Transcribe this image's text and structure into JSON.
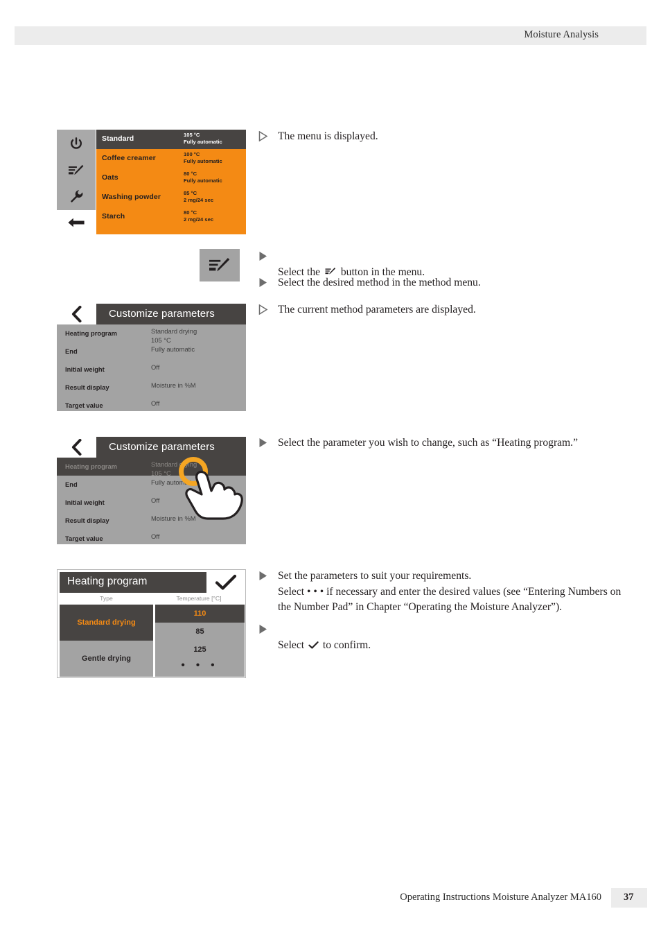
{
  "header": {
    "title": "Moisture Analysis"
  },
  "footer": {
    "text": "Operating Instructions Moisture Analyzer MA160",
    "page": "37"
  },
  "colors": {
    "orange": "#F48A14",
    "dark_gray": "#474442",
    "mid_gray": "#A3A3A3",
    "touch_ring": "#F5A623"
  },
  "screens": {
    "method_menu": {
      "sidebar": [
        {
          "icon": "power-icon"
        },
        {
          "icon": "method-edit-icon"
        },
        {
          "icon": "wrench-icon"
        },
        {
          "icon": "back-arrow-icon"
        }
      ],
      "rows": [
        {
          "name": "Standard",
          "temp": "105 °C",
          "mode": "Fully automatic",
          "selected": true
        },
        {
          "name": "Coffee creamer",
          "temp": "100 °C",
          "mode": "Fully automatic",
          "selected": false
        },
        {
          "name": "Oats",
          "temp": "80 °C",
          "mode": "Fully automatic",
          "selected": false
        },
        {
          "name": "Washing powder",
          "temp": "85 °C",
          "mode": "2 mg/24 sec",
          "selected": false
        },
        {
          "name": "Starch",
          "temp": "80 °C",
          "mode": "2 mg/24 sec",
          "selected": false
        }
      ]
    },
    "edit_button": {
      "icon": "method-edit-icon"
    },
    "customize_parameters": {
      "title": "Customize parameters",
      "back_icon": "chevron-left-icon",
      "rows": [
        {
          "label": "Heating program",
          "value": "Standard drying\n105 °C"
        },
        {
          "label": "End",
          "value": "Fully automatic"
        },
        {
          "label": "Initial weight",
          "value": "Off"
        },
        {
          "label": "Result display",
          "value": "Moisture in %M"
        },
        {
          "label": "Target value",
          "value": "Off"
        }
      ]
    },
    "customize_parameters_touch": {
      "title": "Customize parameters",
      "back_icon": "chevron-left-icon",
      "rows": [
        {
          "label": "Heating program",
          "value": "Standard drying\n105 °C",
          "highlight": true
        },
        {
          "label": "End",
          "value": "Fully automatic"
        },
        {
          "label": "Initial weight",
          "value": "Off"
        },
        {
          "label": "Result display",
          "value": "Moisture in %M"
        },
        {
          "label": "Target value",
          "value": "Off"
        }
      ],
      "touch_indicator": "hand-tap-cursor"
    },
    "heating_program": {
      "title": "Heating program",
      "confirm_icon": "checkmark-icon",
      "columns": [
        "Type",
        "Temperature [°C]"
      ],
      "types": [
        {
          "label": "Standard drying",
          "selected": true
        },
        {
          "label": "Gentle drying",
          "selected": false
        }
      ],
      "temperatures": [
        {
          "label": "110",
          "selected": true
        },
        {
          "label": "85",
          "selected": false
        },
        {
          "label": "125",
          "selected": false
        },
        {
          "label": "• • •",
          "selected": false,
          "is_dots": true
        }
      ]
    }
  },
  "instructions": [
    {
      "marker": "result",
      "text": "The menu is displayed."
    },
    {
      "marker": "action",
      "text": "Select the ❚ button in the menu.",
      "has_icon": true,
      "pre": "Select the ",
      "post": " button in the menu."
    },
    {
      "marker": "action",
      "text": "Select the desired method in the method menu."
    },
    {
      "marker": "result",
      "text": "The current method parameters are displayed."
    },
    {
      "marker": "action",
      "text": "Select the parameter you wish to change, such as “Heating program.”"
    },
    {
      "marker": "action",
      "text": "Set the parameters to suit your requirements.\nSelect • • • if necessary and enter the desired values (see “Entering Numbers on\nthe Number Pad” in Chapter “Operating the Moisture Analyzer”)."
    },
    {
      "marker": "action",
      "pre": "Select ",
      "post": " to confirm.",
      "text": "Select ✔ to confirm.",
      "has_check": true
    }
  ]
}
